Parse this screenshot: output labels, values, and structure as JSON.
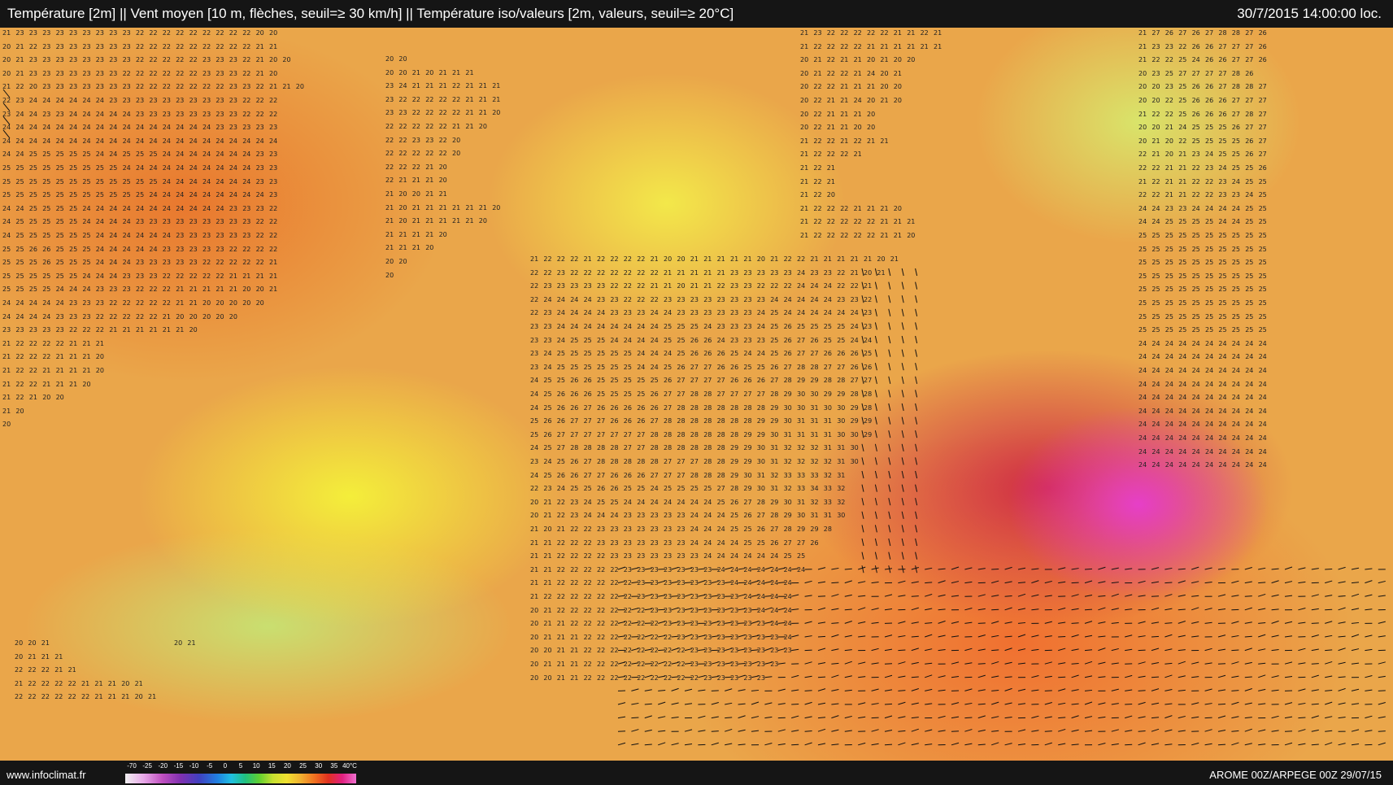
{
  "header": {
    "title": "Température [2m] || Vent moyen [10 m, flèches, seuil=≥ 30 km/h] || Température iso/valeurs [2m, valeurs, seuil=≥ 20°C]",
    "datetime": "30/7/2015 14:00:00 loc."
  },
  "footer": {
    "source": "www.infoclimat.fr",
    "model": "AROME 00Z/ARPEGE 00Z 29/07/15",
    "legend_ticks": [
      "-70",
      "-25",
      "-20",
      "-15",
      "-10",
      "-5",
      "0",
      "5",
      "10",
      "15",
      "20",
      "25",
      "30",
      "35",
      "40°C"
    ]
  },
  "colors": {
    "hot_magenta": "#e63fc8",
    "warm_red": "#cf2a45",
    "orange": "#f07030",
    "yellow": "#f4ee3a",
    "green_relief": "#c9df70",
    "bar_background": "#151515"
  },
  "value_blocks": [
    {
      "rows": [
        "21 23 23 23 23 23 23 23 23 23 22 22 22 22 22 22 22 22 22 20 20",
        "20 21 22 23 23 23 23 23 23 23 22 22 22 22 22 22 22 22 22 21 21",
        "20 21 23 23 23 23 23 23 23 23 22 22 22 22 22 23 23 23 22 21 20 20",
        "20 21 23 23 23 23 23 23 23 22 22 22 22 22 22 23 23 23 22 21 20",
        "21 22 20 23 23 23 23 23 23 23 22 22 22 22 22 22 22 23 23 22 21 21 20",
        "22 23 24 24 24 24 24 24 23 23 23 23 23 23 23 23 23 23 22 22 22",
        "23 24 24 23 23 24 24 24 24 24 23 23 23 23 23 23 23 23 22 22 22",
        "24 24 24 24 24 24 24 24 24 24 24 24 24 24 24 24 23 23 23 23 23",
        "24 24 24 24 24 24 24 24 24 24 24 24 24 24 24 24 24 24 24 24 24",
        "24 24 25 25 25 25 25 24 24 25 25 25 24 24 24 24 24 24 24 23 23",
        "25 25 25 25 25 25 25 25 25 24 24 24 24 24 24 24 24 24 24 23 23",
        "25 25 25 25 25 25 25 25 25 25 25 25 24 24 24 24 24 24 24 23 23",
        "25 25 25 25 25 25 25 25 25 25 25 24 24 24 24 24 24 24 24 24 23",
        "24 24 25 25 25 25 24 24 24 24 24 24 24 24 24 24 24 23 23 23 22",
        "24 25 25 25 25 25 24 24 24 24 23 23 23 23 23 23 23 23 23 22 22",
        "24 25 25 25 25 25 25 24 24 24 24 24 24 23 23 23 23 23 23 22 22",
        "25 25 26 26 25 25 25 24 24 24 24 24 23 23 23 23 23 22 22 22 22",
        "25 25 25 26 25 25 25 24 24 24 23 23 23 23 23 22 22 22 22 22 21",
        "25 25 25 25 25 25 24 24 24 23 23 23 22 22 22 22 22 21 21 21 21",
        "25 25 25 25 24 24 24 23 23 23 22 22 22 21 21 21 21 21 20 20 21",
        "24 24 24 24 24 23 23 23 22 22 22 22 22 21 21 20 20 20 20 20",
        "24 24 24 24 23 23 23 22 22 22 22 22 21 20 20 20 20 20",
        "23 23 23 23 23 22 22 22 21 21 21 21 21 21 20",
        "21 22 22 22 22 21 21 21",
        "21 22 22 22 21 21 21 20",
        "21 22 22 21 21 21 21 20",
        "21 22 22 21 21 21 20",
        "21 22 21 20 20",
        "21 20",
        "20"
      ]
    },
    {
      "rows": [
        "20 20",
        "20 20 21 20 21 21 21",
        "23 24 21 21 21 22 21 21 21",
        "23 22 22 22 22 22 21 21 21",
        "23 23 22 22 22 22 21 21 20",
        "22 22 22 22 22 21 21 20",
        "22 22 23 23 22 20",
        "22 22 22 22 22 20",
        "22 22 22 21 20",
        "22 21 21 21 20",
        "21 20 20 21 21",
        "21 20 21 21 21 21 21 21 20",
        "21 20 21 21 21 21 21 20",
        "21 21 21 21 20",
        "21 21 21 20",
        "20 20",
        "20"
      ]
    },
    {
      "rows": [
        "21 23 22 22 22 22 22 21 21 22 21",
        "21 22 22 22 22 21 21 21 21 21 21",
        "20 21 22 21 21 20 21 20 20",
        "20 21 22 22 21 24 20 21",
        "20 22 22 21 21 21 20 20",
        "20 22 21 21 24 20 21 20",
        "20 22 21 21 21 20",
        "20 22 21 21 20 20",
        "21 22 22 21 22 21 21",
        "21 22 22 22 21",
        "21 22 21",
        "21 22 21",
        "21 22 20",
        "21 22 22 22 21 21 21 20",
        "21 22 22 22 22 22 21 21 21",
        "21 22 22 22 22 22 21 21 20"
      ]
    },
    {
      "rows": [
        "21 22 22 22 21 22 22 22 22 21 20 20 21 21 21 21 21 20 21 22 22 21 21 21 21 21 20 21",
        "22 22 23 22 22 22 22 22 22 22 21 21 21 21 21 23 23 23 23 23 24 23 23 22 21 20 21",
        "22 23 23 23 23 23 22 22 22 21 21 20 21 21 22 23 23 22 22 22 24 24 24 22 22 21",
        "22 24 24 24 24 23 23 22 22 22 23 23 23 23 23 23 23 23 24 24 24 24 24 23 23 22",
        "22 23 24 24 24 24 23 23 23 24 24 23 23 23 23 23 23 24 25 24 24 24 24 24 24 23",
        "23 23 24 24 24 24 24 24 24 24 25 25 25 24 23 23 23 24 25 26 25 25 25 25 24 23",
        "23 23 24 25 25 25 24 24 24 24 25 25 26 26 24 23 23 23 25 26 27 26 25 25 24 24",
        "23 24 25 25 25 25 25 25 24 24 24 25 26 26 26 25 24 24 25 26 27 27 26 26 26 25",
        "23 24 25 25 25 25 25 25 24 24 25 26 27 27 26 26 25 25 26 27 28 28 27 27 26 26",
        "24 25 25 26 26 25 25 25 25 25 26 27 27 27 27 26 26 26 27 28 29 29 28 28 27 27",
        "24 25 26 26 26 25 25 25 25 26 27 27 28 28 27 27 27 27 28 29 30 30 29 29 28 28",
        "24 25 26 26 27 26 26 26 26 26 27 28 28 28 28 28 28 28 29 30 30 31 30 30 29 28",
        "25 26 26 27 27 27 26 26 26 27 28 28 28 28 28 28 28 29 29 30 31 31 31 30 29 29",
        "25 26 27 27 27 27 27 27 27 28 28 28 28 28 28 28 29 29 30 31 31 31 31 30 30 29",
        "24 25 27 28 28 28 28 27 27 28 28 28 28 28 28 29 29 30 31 32 32 32 31 31 30",
        "23 24 25 26 27 28 28 28 28 28 27 27 27 28 28 29 29 30 31 32 32 32 32 31 30",
        "24 25 26 26 27 27 26 26 26 27 27 27 28 28 28 29 30 31 32 33 33 33 32 31",
        "22 23 24 25 25 26 26 25 25 24 25 25 25 25 27 28 29 30 31 32 33 34 33 32",
        "20 21 22 23 24 25 25 24 24 24 24 24 24 24 25 26 27 28 29 30 31 32 33 32",
        "20 21 22 23 24 24 24 23 23 23 23 23 24 24 24 25 26 27 28 29 30 31 31 30",
        "21 20 21 22 22 23 23 23 23 23 23 23 24 24 24 25 25 26 27 28 29 29 28",
        "21 21 22 22 22 23 23 23 23 23 23 23 24 24 24 24 25 25 26 27 27 26",
        "21 21 22 22 22 22 23 23 23 23 23 23 23 24 24 24 24 24 24 25 25",
        "21 21 22 22 22 22 22 23 23 23 23 23 23 23 24 24 24 24 24 24 24",
        "21 21 22 22 22 22 22 22 23 23 23 23 23 23 23 24 24 24 24 24",
        "21 22 22 22 22 22 22 22 23 23 23 23 23 23 23 23 24 24 24 24",
        "20 21 22 22 22 22 22 22 22 23 23 23 23 23 23 23 23 24 24 24",
        "20 21 21 22 22 22 22 22 22 22 23 23 23 23 23 23 23 23 24 24",
        "20 21 21 21 22 22 22 22 22 22 22 23 23 23 23 23 23 23 23 24",
        "20 20 21 21 22 22 22 22 22 22 22 22 23 23 23 23 23 23 23 23",
        "20 21 21 21 22 22 22 22 22 22 22 22 23 23 23 23 23 23 23",
        "20 20 21 21 22 22 22 22 22 22 22 22 22 23 23 23 23 23"
      ]
    },
    {
      "rows": [
        "21 27 26 27 26 27 28 28 27 26",
        "21 23 23 22 26 26 27 27 27 26",
        "21 22 22 25 24 26 26 27 27 26",
        "20 23 25 27 27 27 27 28 26",
        "20 20 23 25 26 26 27 28 28 27",
        "20 20 22 25 26 26 26 27 27 27",
        "21 22 22 25 26 26 26 27 28 27",
        "20 20 21 24 25 25 25 26 27 27",
        "20 21 20 22 25 25 25 25 26 27",
        "22 21 20 21 23 24 25 25 26 27",
        "22 22 21 21 22 23 24 25 25 26",
        "21 22 21 21 22 22 23 24 25 25",
        "22 22 21 21 22 22 23 23 24 25",
        "24 24 23 23 24 24 24 24 25 25",
        "24 24 25 25 25 25 24 24 25 25",
        "25 25 25 25 25 25 25 25 25 25",
        "25 25 25 25 25 25 25 25 25 25",
        "25 25 25 25 25 25 25 25 25 25",
        "25 25 25 25 25 25 25 25 25 25",
        "25 25 25 25 25 25 25 25 25 25",
        "25 25 25 25 25 25 25 25 25 25",
        "25 25 25 25 25 25 25 25 25 25",
        "25 25 25 25 25 25 25 25 25 25",
        "24 24 24 24 24 24 24 24 24 24",
        "24 24 24 24 24 24 24 24 24 24",
        "24 24 24 24 24 24 24 24 24 24",
        "24 24 24 24 24 24 24 24 24 24",
        "24 24 24 24 24 24 24 24 24 24",
        "24 24 24 24 24 24 24 24 24 24",
        "24 24 24 24 24 24 24 24 24 24",
        "24 24 24 24 24 24 24 24 24 24",
        "24 24 24 24 24 24 24 24 24 24",
        "24 24 24 24 24 24 24 24 24 24"
      ]
    },
    {
      "rows": [
        "20 20 21",
        "20 21 21 21",
        "22 22 22 21 21",
        "21 22 22 22 22 21 21 21 20 21",
        "22 22 22 22 22 22 21 21 21 20 21"
      ]
    },
    {
      "rows": [
        "20 21"
      ]
    }
  ]
}
